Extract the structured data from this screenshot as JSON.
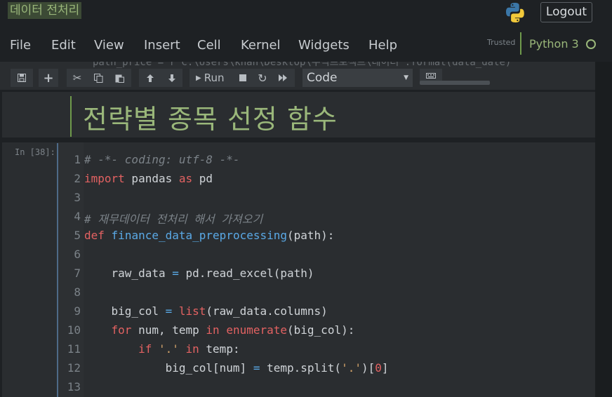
{
  "header": {
    "notebook_title": "데이터 전처리",
    "logout_label": "Logout"
  },
  "menubar": {
    "items": [
      "File",
      "Edit",
      "View",
      "Insert",
      "Cell",
      "Kernel",
      "Widgets",
      "Help"
    ],
    "trusted_label": "Trusted",
    "kernel_name": "Python 3"
  },
  "toolbar": {
    "ghost_code": "path_price = r'C:\\Users\\khan\\Desktop\\주식프로젝트\\데이터'.format(data_date)",
    "run_label": "Run",
    "cell_type": "Code"
  },
  "markdown_cell": {
    "heading": "전략별 종목 선정 함수"
  },
  "code_cell": {
    "prompt": "In [38]:",
    "line_numbers": [
      "1",
      "2",
      "3",
      "4",
      "5",
      "6",
      "7",
      "8",
      "9",
      "10",
      "11",
      "12",
      "13"
    ],
    "lines": [
      [
        {
          "t": "cm",
          "v": "# -*- coding: utf-8 -*-"
        }
      ],
      [
        {
          "t": "kw",
          "v": "import"
        },
        {
          "t": "tx",
          "v": " pandas "
        },
        {
          "t": "kw",
          "v": "as"
        },
        {
          "t": "tx",
          "v": " pd"
        }
      ],
      [],
      [
        {
          "t": "cm",
          "v": "# 재무데이터 전처리 해서 가져오기"
        }
      ],
      [
        {
          "t": "kw",
          "v": "def"
        },
        {
          "t": "tx",
          "v": " "
        },
        {
          "t": "fn",
          "v": "finance_data_preprocessing"
        },
        {
          "t": "tx",
          "v": "(path):"
        }
      ],
      [],
      [
        {
          "t": "tx",
          "v": "    raw_data "
        },
        {
          "t": "op",
          "v": "="
        },
        {
          "t": "tx",
          "v": " pd.read_excel(path)"
        }
      ],
      [],
      [
        {
          "t": "tx",
          "v": "    big_col "
        },
        {
          "t": "op",
          "v": "="
        },
        {
          "t": "tx",
          "v": " "
        },
        {
          "t": "bi",
          "v": "list"
        },
        {
          "t": "tx",
          "v": "(raw_data.columns)"
        }
      ],
      [
        {
          "t": "tx",
          "v": "    "
        },
        {
          "t": "kw",
          "v": "for"
        },
        {
          "t": "tx",
          "v": " num, temp "
        },
        {
          "t": "kw",
          "v": "in"
        },
        {
          "t": "tx",
          "v": " "
        },
        {
          "t": "bi",
          "v": "enumerate"
        },
        {
          "t": "tx",
          "v": "(big_col):"
        }
      ],
      [
        {
          "t": "tx",
          "v": "        "
        },
        {
          "t": "kw",
          "v": "if"
        },
        {
          "t": "tx",
          "v": " "
        },
        {
          "t": "st",
          "v": "'.'"
        },
        {
          "t": "tx",
          "v": " "
        },
        {
          "t": "kw",
          "v": "in"
        },
        {
          "t": "tx",
          "v": " temp:"
        }
      ],
      [
        {
          "t": "tx",
          "v": "            big_col[num] "
        },
        {
          "t": "op",
          "v": "="
        },
        {
          "t": "tx",
          "v": " temp.split("
        },
        {
          "t": "st",
          "v": "'.'"
        },
        {
          "t": "tx",
          "v": ")["
        },
        {
          "t": "nm",
          "v": "0"
        },
        {
          "t": "tx",
          "v": "]"
        }
      ],
      []
    ]
  }
}
